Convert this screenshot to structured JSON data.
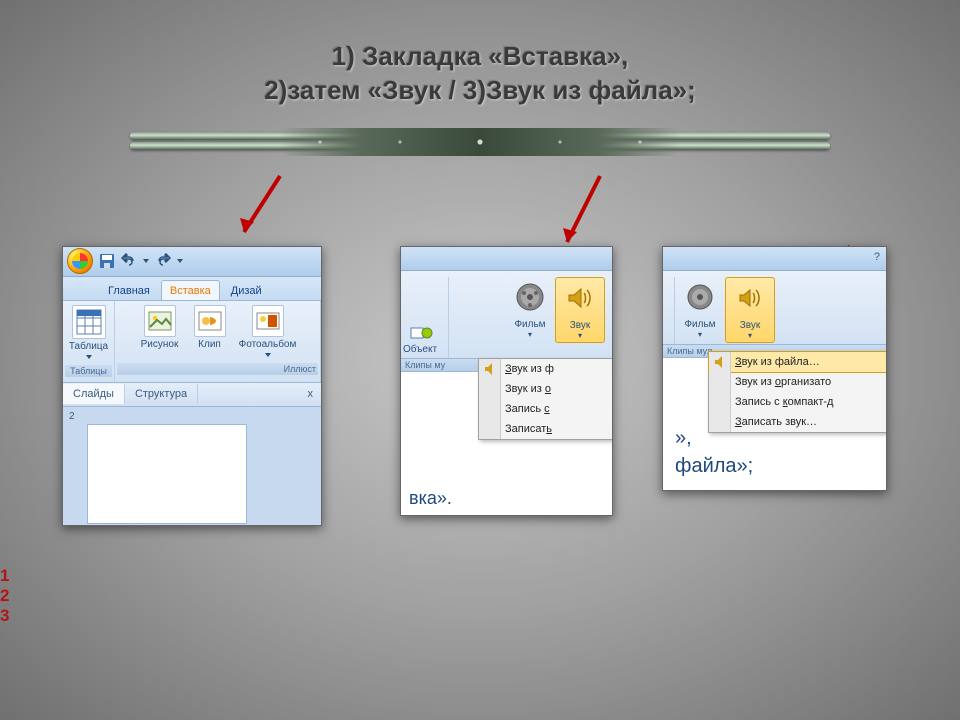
{
  "title_line1": "1) Закладка «Вставка»,",
  "title_line2": "2)затем  «Звук / 3)Звук из файла»;",
  "panel1": {
    "tabs": {
      "home": "Главная",
      "insert": "Вставка",
      "design": "Дизай"
    },
    "group_tables": "Таблицы",
    "btn_table": "Таблица",
    "btn_picture": "Рисунок",
    "btn_clip": "Клип",
    "btn_album": "Фотоальбом",
    "group_illus": "Иллюст",
    "nav_slides": "Слайды",
    "nav_outline": "Структура",
    "slide_num": "2"
  },
  "panel2": {
    "btn_object": "Объект",
    "btn_movie": "Фильм",
    "btn_sound": "Звук",
    "group_clips": "Клипы му",
    "menu": {
      "m1": "Звук из ф",
      "m2": "Звук из о",
      "m3": "Запись с",
      "m4": "Записать"
    },
    "partial": "вка»."
  },
  "panel3": {
    "btn_movie": "Фильм",
    "btn_sound": "Звук",
    "group_clips": "Клипы мул",
    "menu": {
      "m1": "Звук из файла…",
      "m2": "Звук из организато",
      "m3": "Запись с компакт-д",
      "m4": "Записать звук…"
    },
    "partial1": "»,",
    "partial2": "файла»;"
  },
  "steps": {
    "s1": "1",
    "s2": "2",
    "s3": "3"
  }
}
